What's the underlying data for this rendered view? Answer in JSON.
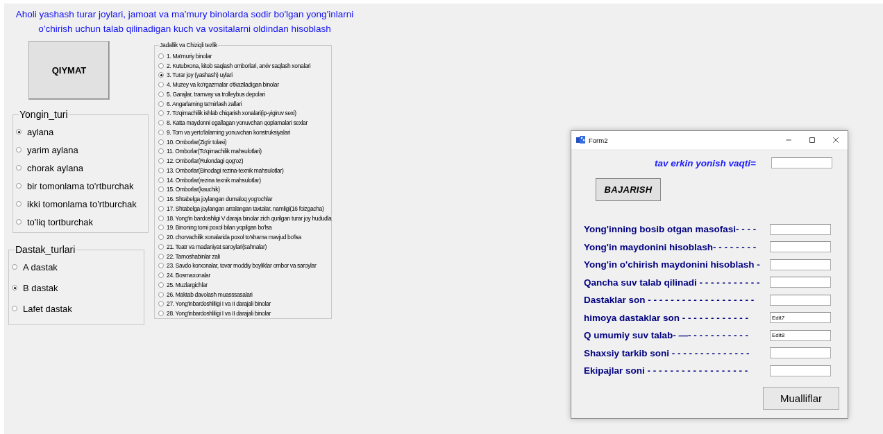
{
  "heading": [
    "Aholi yashash turar joylari, jamoat va ma'mury binolarda sodir bo'lgan yong'inlarni",
    "o'chirish uchun talab qilinadigan kuch va vositalarni oldindan hisoblash"
  ],
  "qiymat_button": "QIYMAT",
  "yongin_turi": {
    "title": "Yongin_turi",
    "options": [
      {
        "label": "aylana",
        "selected": true
      },
      {
        "label": "yarim aylana",
        "selected": false
      },
      {
        "label": "chorak aylana",
        "selected": false
      },
      {
        "label": "bir tomonlama to'rtburchak",
        "selected": false
      },
      {
        "label": "ikki tomonlama to'rtburchak",
        "selected": false
      },
      {
        "label": "to'liq tortburchak",
        "selected": false
      }
    ]
  },
  "dastak_turlari": {
    "title": "Dastak_turlari",
    "options": [
      {
        "label": "A dastak",
        "selected": false
      },
      {
        "label": "B dastak",
        "selected": true
      },
      {
        "label": "Lafet dastak",
        "selected": false
      }
    ]
  },
  "tezlik": {
    "title": "Jadallik va Chiziqli tezlik",
    "options": [
      {
        "label": "1. Ma'muriy binolar",
        "selected": false
      },
      {
        "label": "2. Kutubxona, kitob saqlash omborlari, arxiv saqlash xonalari",
        "selected": false
      },
      {
        "label": "3. Turar joy (yashash) uylari",
        "selected": true
      },
      {
        "label": "4. Muzey va ko'rgazmalar o'tkaziladigan binolar",
        "selected": false
      },
      {
        "label": "5. Garajlar, tramvay va trolleybus depolari",
        "selected": false
      },
      {
        "label": "6. Angarlarning ta'mirlash zallari",
        "selected": false
      },
      {
        "label": "7. To'qimachilik ishlab chiqarish xonalari(ip-yigiruv sexi)",
        "selected": false
      },
      {
        "label": "8. Katta maydonni egallagan yonuvchan qoplamalari sexlar",
        "selected": false
      },
      {
        "label": "9. Tom va yerto'lalarning yonuvchan konstruksiyalari",
        "selected": false
      },
      {
        "label": "10. Omborlar(Zig'ir tolasi)",
        "selected": false
      },
      {
        "label": "11. Omborlar(To'qimachilik mahsulotlari)",
        "selected": false
      },
      {
        "label": "12. Omborlar(Rulondagi qog'oz)",
        "selected": false
      },
      {
        "label": "13. Omborlar(Binodagi rezina-texnik mahsulotlar)",
        "selected": false
      },
      {
        "label": "14. Omborlar(rezina texnik mahsulotlar)",
        "selected": false
      },
      {
        "label": "15. Omborlar(kauchik)",
        "selected": false
      },
      {
        "label": "16. Shtabelga joylangan dumaloq yog'ochlar",
        "selected": false
      },
      {
        "label": "17. Shtabelga joylangan arralangan taxtalar, namligi(16 foizgacha)",
        "selected": false
      },
      {
        "label": "18. Yong'in bardoshligi V daraja binolar zich qurilgan turar joy hududla",
        "selected": false
      },
      {
        "label": "19. Binoning tomi poxol bilan yopilgan bo'lsa",
        "selected": false
      },
      {
        "label": "20. chorvachilik xonalarida poxol to'shama mavjud bo'lsa",
        "selected": false
      },
      {
        "label": "21. Teatr va madaniyat saroylari(sahnalar)",
        "selected": false
      },
      {
        "label": "22. Tamoshabinlar zali",
        "selected": false
      },
      {
        "label": "23. Savdo korxonalar, tovar moddiy boyliklar ombor va saroylar",
        "selected": false
      },
      {
        "label": "24. Bosmaxonalar",
        "selected": false
      },
      {
        "label": "25. Muzlargichlar",
        "selected": false
      },
      {
        "label": "26. Maktab davolash muasssasalari",
        "selected": false
      },
      {
        "label": "27. Yong'inbardoshliligi I va II darajali binolar",
        "selected": false
      },
      {
        "label": "28. Yong'inbardoshliligi I va II darajali binolar",
        "selected": false
      }
    ]
  },
  "form2": {
    "title": "Form2",
    "time_label": "tav erkin yonish vaqti=",
    "run_button": "BAJARISH",
    "rows": [
      {
        "label": "Yong'inning bosib otgan masofasi- - - -"
      },
      {
        "label": "Yong'in maydonini hisoblash- - - - - - - -"
      },
      {
        "label": "Yong'in o'chirish maydonini hisoblash -"
      },
      {
        "label": "Qancha suv talab qilinadi - - - - - - - - - - -"
      },
      {
        "label": "Dastaklar son - - - - - - - - - - - - - - - - - - -"
      },
      {
        "label": "himoya dastaklar son - - - - - - - - -  - - -",
        "value": "Edit7"
      },
      {
        "label": "Q umumiy suv talab- —- - - - - - - -  - - -",
        "value": "Edit8"
      },
      {
        "label": "Shaxsiy tarkib soni - - - - - - - - - - - - - -"
      },
      {
        "label": "Ekipajlar soni - - - - - - - - - - - - - - - - - -"
      }
    ],
    "authors_button": "Mualliflar"
  }
}
